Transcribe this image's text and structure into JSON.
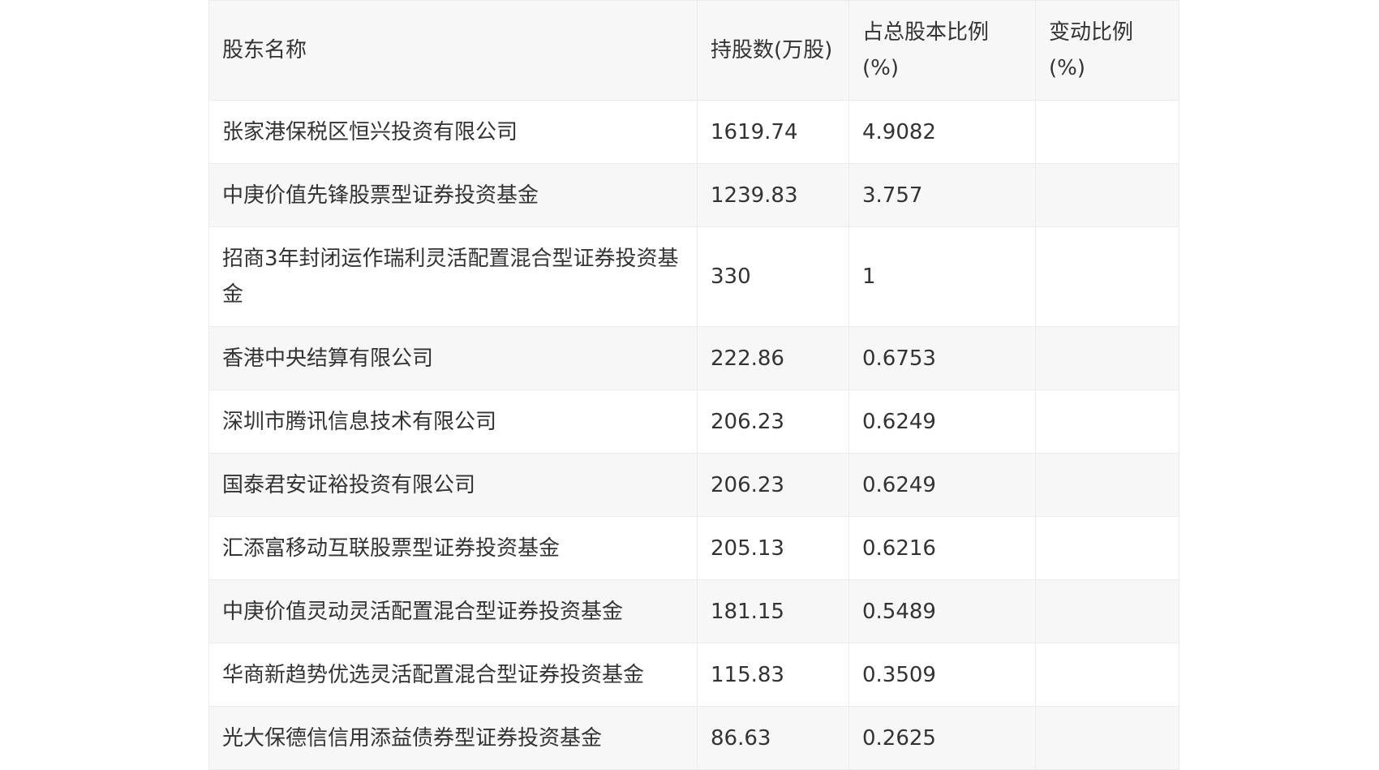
{
  "headers": {
    "name": "股东名称",
    "shares": "持股数(万股)",
    "ratio": "占总股本比例(%)",
    "change": "变动比例(%)"
  },
  "rows": [
    {
      "name": "张家港保税区恒兴投资有限公司",
      "shares": "1619.74",
      "ratio": "4.9082",
      "change": ""
    },
    {
      "name": "中庚价值先锋股票型证券投资基金",
      "shares": "1239.83",
      "ratio": "3.757",
      "change": ""
    },
    {
      "name": "招商3年封闭运作瑞利灵活配置混合型证券投资基金",
      "shares": "330",
      "ratio": "1",
      "change": ""
    },
    {
      "name": "香港中央结算有限公司",
      "shares": "222.86",
      "ratio": "0.6753",
      "change": ""
    },
    {
      "name": "深圳市腾讯信息技术有限公司",
      "shares": "206.23",
      "ratio": "0.6249",
      "change": ""
    },
    {
      "name": "国泰君安证裕投资有限公司",
      "shares": "206.23",
      "ratio": "0.6249",
      "change": ""
    },
    {
      "name": "汇添富移动互联股票型证券投资基金",
      "shares": "205.13",
      "ratio": "0.6216",
      "change": ""
    },
    {
      "name": "中庚价值灵动灵活配置混合型证券投资基金",
      "shares": "181.15",
      "ratio": "0.5489",
      "change": ""
    },
    {
      "name": "华商新趋势优选灵活配置混合型证券投资基金",
      "shares": "115.83",
      "ratio": "0.3509",
      "change": ""
    },
    {
      "name": "光大保德信信用添益债券型证券投资基金",
      "shares": "86.63",
      "ratio": "0.2625",
      "change": ""
    }
  ]
}
